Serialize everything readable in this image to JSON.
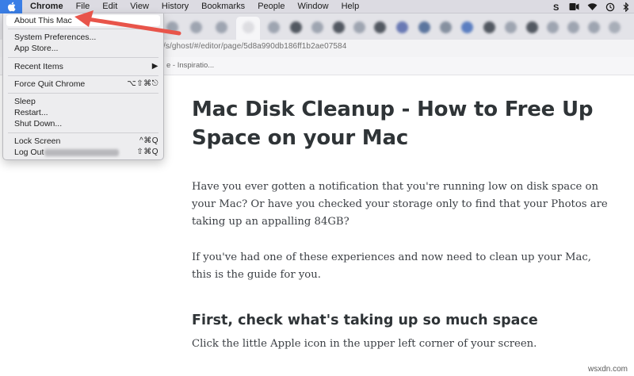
{
  "menubar": {
    "items": [
      "Chrome",
      "File",
      "Edit",
      "View",
      "History",
      "Bookmarks",
      "People",
      "Window",
      "Help"
    ],
    "status_icons": [
      "skype-icon",
      "media-icon",
      "wifi-icon",
      "time-machine-icon",
      "bluetooth-icon"
    ]
  },
  "browser": {
    "url": "/s/ghost/#/editor/page/5d8a990db186ff1b2ae07584",
    "bookmark": "e - Inspiratio..."
  },
  "apple_menu": {
    "about": "About This Mac",
    "system_preferences": "System Preferences...",
    "app_store": "App Store...",
    "recent_items": "Recent Items",
    "force_quit": "Force Quit Chrome",
    "force_quit_shortcut": "⌥⇧⌘⎋",
    "sleep": "Sleep",
    "restart": "Restart...",
    "shut_down": "Shut Down...",
    "lock_screen": "Lock Screen",
    "lock_screen_shortcut": "^⌘Q",
    "log_out": "Log Out",
    "log_out_shortcut": "⇧⌘Q"
  },
  "article": {
    "title": "Mac Disk Cleanup - How to Free Up Space on your Mac",
    "p1": "Have you ever gotten a notification that you're running low on disk space on your Mac? Or have you checked your storage only to find that your Photos are taking up an appalling 84GB?",
    "p2": "If you've had one of these experiences and now need to clean up your Mac, this is the guide for you.",
    "subheading": "First, check what's taking up so much space",
    "p3": "Click the little Apple icon in the upper left corner of your screen."
  },
  "watermark": "wsxdn.com",
  "colors": {
    "accent": "#3a7ee6",
    "arrow": "#e8544a",
    "heading": "#2f3437",
    "body_text": "#3b3f44"
  }
}
